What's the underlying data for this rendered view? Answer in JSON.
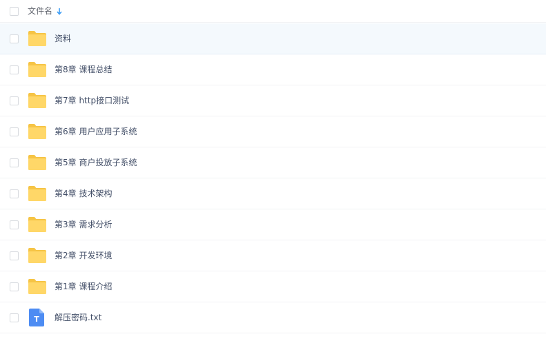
{
  "header": {
    "column_label": "文件名",
    "sort": "descending"
  },
  "colors": {
    "folder": "#ffd768",
    "folder_tab": "#f6c445",
    "txt_icon": "#4d8cf3",
    "selected_row": "#f4f9fd",
    "text": "#424e67",
    "sort_arrow": "#3b9cf5"
  },
  "files": [
    {
      "name": "资料",
      "type": "folder",
      "icon": "folder-icon",
      "selected": true
    },
    {
      "name": "第8章 课程总结",
      "type": "folder",
      "icon": "folder-icon"
    },
    {
      "name": "第7章 http接口测试",
      "type": "folder",
      "icon": "folder-icon"
    },
    {
      "name": "第6章 用户应用子系统",
      "type": "folder",
      "icon": "folder-icon"
    },
    {
      "name": "第5章 商户投放子系统",
      "type": "folder",
      "icon": "folder-icon"
    },
    {
      "name": "第4章 技术架构",
      "type": "folder",
      "icon": "folder-icon"
    },
    {
      "name": "第3章 需求分析",
      "type": "folder",
      "icon": "folder-icon"
    },
    {
      "name": "第2章 开发环境",
      "type": "folder",
      "icon": "folder-icon"
    },
    {
      "name": "第1章 课程介绍",
      "type": "folder",
      "icon": "folder-icon"
    },
    {
      "name": "解压密码.txt",
      "type": "txt",
      "icon": "txt-file-icon",
      "icon_letter": "T"
    }
  ]
}
